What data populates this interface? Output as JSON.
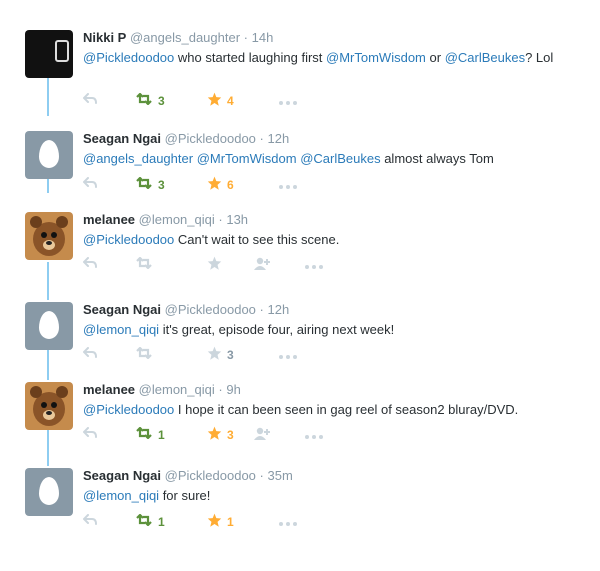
{
  "colors": {
    "mention": "#2b7bb9",
    "retweet": "#5c913b",
    "favorite": "#ffac33",
    "muted": "#ccd6dd",
    "thread": "#8ecdf1"
  },
  "tweets": [
    {
      "name": "Nikki P",
      "handle": "@angels_daughter",
      "sep": "·",
      "time": "14h",
      "avatar": "dark-logo-avatar",
      "parts": [
        {
          "t": "@Pickledoodoo",
          "m": true
        },
        {
          "t": " who started laughing first ",
          "m": false
        },
        {
          "t": "@MrTomWisdom",
          "m": true
        },
        {
          "t": " or ",
          "m": false
        },
        {
          "t": "@CarlBeukes",
          "m": true
        },
        {
          "t": "? Lol",
          "m": false
        }
      ],
      "retweets": "3",
      "favorites": "4",
      "retweeted": true,
      "favorited": true,
      "follow": false
    },
    {
      "name": "Seagan Ngai",
      "handle": "@Pickledoodoo",
      "sep": "·",
      "time": "12h",
      "avatar": "egg-avatar",
      "parts": [
        {
          "t": "@angels_daughter",
          "m": true
        },
        {
          "t": " ",
          "m": false
        },
        {
          "t": "@MrTomWisdom",
          "m": true
        },
        {
          "t": " ",
          "m": false
        },
        {
          "t": "@CarlBeukes",
          "m": true
        },
        {
          "t": " almost always Tom",
          "m": false
        }
      ],
      "retweets": "3",
      "favorites": "6",
      "retweeted": true,
      "favorited": true,
      "follow": false
    },
    {
      "name": "melanee",
      "handle": "@lemon_qiqi",
      "sep": "·",
      "time": "13h",
      "avatar": "bear-avatar",
      "parts": [
        {
          "t": "@Pickledoodoo",
          "m": true
        },
        {
          "t": " Can't wait to see this scene.",
          "m": false
        }
      ],
      "retweets": "",
      "favorites": "",
      "retweeted": false,
      "favorited": false,
      "follow": true
    },
    {
      "name": "Seagan Ngai",
      "handle": "@Pickledoodoo",
      "sep": "·",
      "time": "12h",
      "avatar": "egg-avatar",
      "parts": [
        {
          "t": "@lemon_qiqi",
          "m": true
        },
        {
          "t": " it's great, episode four, airing next week!",
          "m": false
        }
      ],
      "retweets": "",
      "favorites": "3",
      "retweeted": false,
      "favorited": false,
      "follow": false
    },
    {
      "name": "melanee",
      "handle": "@lemon_qiqi",
      "sep": "·",
      "time": "9h",
      "avatar": "bear-avatar",
      "parts": [
        {
          "t": "@Pickledoodoo",
          "m": true
        },
        {
          "t": " I hope it can been seen in gag reel of season2 bluray/DVD.",
          "m": false
        }
      ],
      "retweets": "1",
      "favorites": "3",
      "retweeted": true,
      "favorited": true,
      "follow": true
    },
    {
      "name": "Seagan Ngai",
      "handle": "@Pickledoodoo",
      "sep": "·",
      "time": "35m",
      "avatar": "egg-avatar",
      "parts": [
        {
          "t": "@lemon_qiqi",
          "m": true
        },
        {
          "t": " for sure!",
          "m": false
        }
      ],
      "retweets": "1",
      "favorites": "1",
      "retweeted": true,
      "favorited": true,
      "follow": false
    }
  ]
}
